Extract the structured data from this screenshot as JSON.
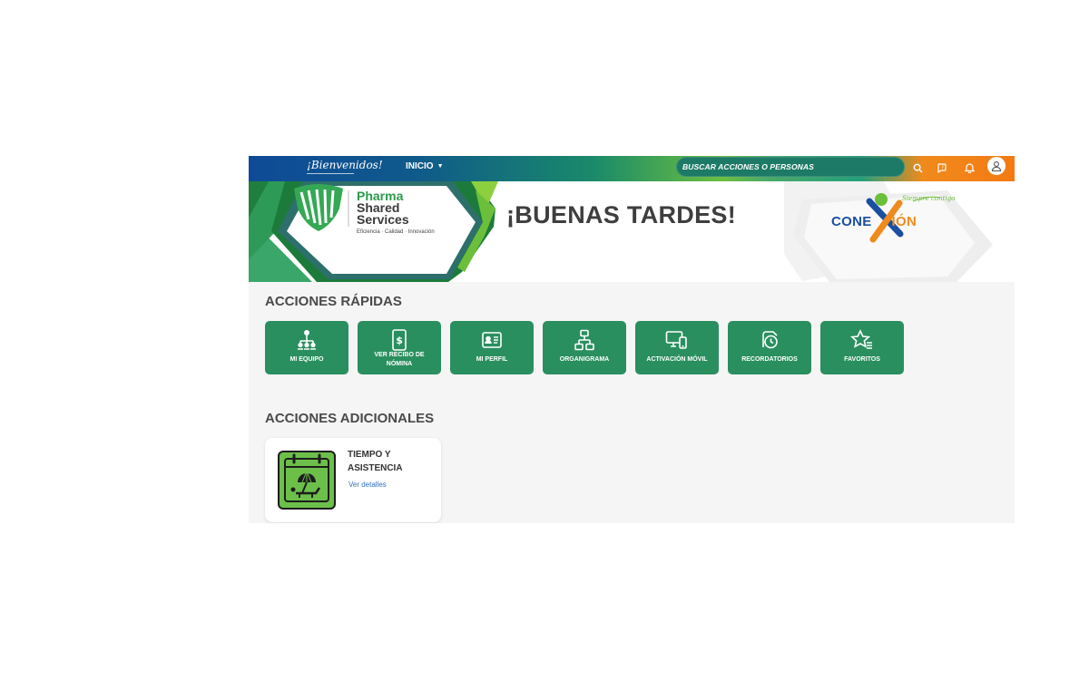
{
  "topbar": {
    "welcome": "¡Bienvenidos!",
    "nav_label": "INICIO",
    "search_placeholder": "BUSCAR ACCIONES O PERSONAS",
    "icons": [
      "search-icon",
      "help-chat-icon",
      "bell-icon",
      "user-avatar-icon"
    ]
  },
  "banner": {
    "logo": {
      "line1": "Pharma",
      "line2": "Shared",
      "line3": "Services",
      "tagline": "Eficiencia · Calidad · Innovación"
    },
    "greeting": "¡BUENAS TARDES!",
    "conexion": {
      "part1": "CONE",
      "part2": "IÓN",
      "slogan": "Siempre contigo"
    }
  },
  "quick_actions": {
    "title": "ACCIONES RÁPIDAS",
    "items": [
      {
        "label": "MI EQUIPO",
        "icon": "team-icon"
      },
      {
        "label": "VER RECIBO DE NÓMINA",
        "icon": "payroll-receipt-icon"
      },
      {
        "label": "MI PERFIL",
        "icon": "id-card-icon"
      },
      {
        "label": "ORGANIGRAMA",
        "icon": "org-chart-icon"
      },
      {
        "label": "ACTIVACIÓN MÓVIL",
        "icon": "devices-icon"
      },
      {
        "label": "RECORDATORIOS",
        "icon": "reminder-clock-icon"
      },
      {
        "label": "FAVORITOS",
        "icon": "favorites-star-icon"
      }
    ]
  },
  "additional_actions": {
    "title": "ACCIONES ADICIONALES",
    "card": {
      "title_line1": "TIEMPO Y",
      "title_line2": "ASISTENCIA",
      "link": "Ver detalles",
      "icon": "calendar-vacation-icon"
    }
  },
  "colors": {
    "tile_green": "#2a8f5f",
    "brand_blue": "#1b4fa1",
    "brand_orange": "#f08a1c",
    "brand_lime": "#6bbf3a"
  }
}
